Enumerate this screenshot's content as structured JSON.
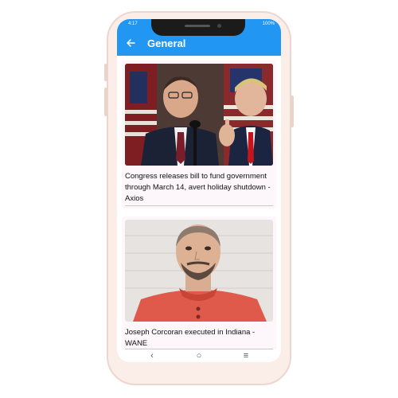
{
  "status_bar": {
    "time": "4:17",
    "battery": "100%"
  },
  "app_bar": {
    "title": "General",
    "back_icon": "arrow-left-icon"
  },
  "articles": [
    {
      "title": "Congress releases bill to fund government through March 14, avert holiday shutdown - Axios",
      "image": "news-photo"
    },
    {
      "title": "Joseph Corcoran executed in Indiana - WANE",
      "image": "news-photo"
    }
  ],
  "nav_bar": {
    "back": "‹",
    "home": "○",
    "recents": "≡"
  },
  "colors": {
    "accent": "#2196f3",
    "phone_frame": "#fbeee9",
    "card_bg": "#fdf6fb"
  }
}
